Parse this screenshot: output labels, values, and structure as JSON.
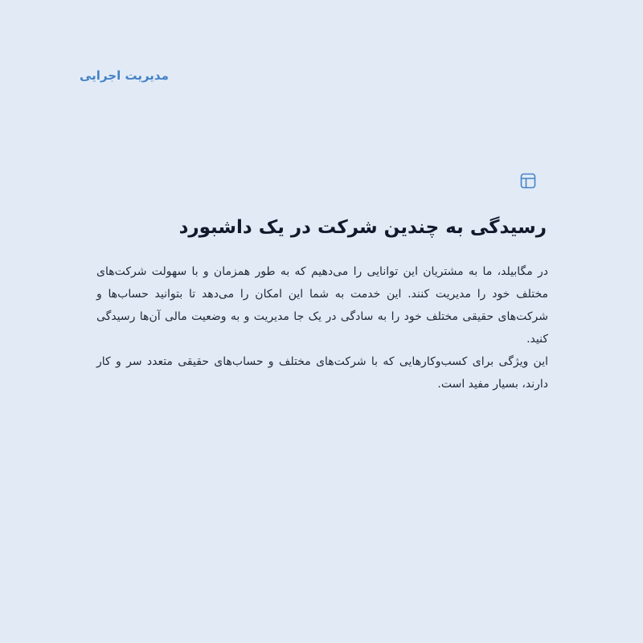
{
  "category": "مدیریت اجرایی",
  "icon": "layout-icon",
  "accent_color": "#4583c7",
  "feature": {
    "title": "رسیدگی به چندین شرکت در یک داشبورد",
    "paragraphs": [
      "در مگابیلد، ما به مشتریان این توانایی را می‌دهیم که به طور همزمان و با سهولت شرکت‌های مختلف خود را مدیریت کنند. این خدمت به شما این امکان را می‌دهد تا بتوانید حساب‌ها و شرکت‌های حقیقی مختلف خود را به سادگی در یک جا مدیریت و به وضعیت مالی آن‌ها رسیدگی کنید.",
      "این ویژگی برای کسب‌وکارهایی که با شرکت‌های مختلف و حساب‌های حقیقی متعدد سر و کار دارند، بسیار مفید است."
    ]
  }
}
